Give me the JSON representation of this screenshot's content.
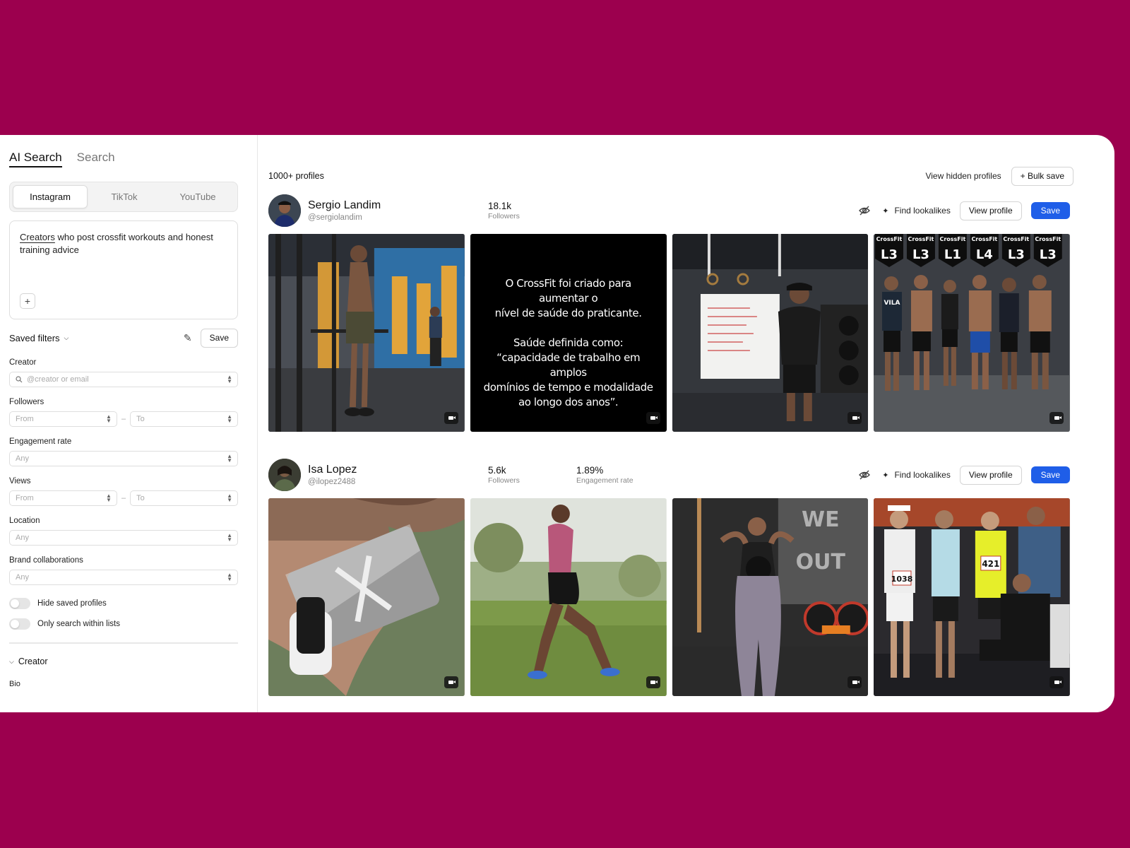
{
  "sidebar": {
    "mode_tabs": [
      "AI Search",
      "Search"
    ],
    "platform_tabs": [
      "Instagram",
      "TikTok",
      "YouTube"
    ],
    "prompt": {
      "underlined": "Creators",
      "rest": " who post crossfit workouts and honest training advice",
      "add": "+"
    },
    "saved_filters": {
      "label": "Saved filters",
      "save_label": "Save"
    },
    "creator": {
      "label": "Creator",
      "placeholder": "@creator or email"
    },
    "followers": {
      "label": "Followers",
      "from": "From",
      "to": "To",
      "dash": "–"
    },
    "engagement": {
      "label": "Engagement rate",
      "value": "Any"
    },
    "views": {
      "label": "Views",
      "from": "From",
      "to": "To",
      "dash": "–"
    },
    "location": {
      "label": "Location",
      "value": "Any"
    },
    "brand": {
      "label": "Brand collaborations",
      "value": "Any"
    },
    "toggles": [
      "Hide saved profiles",
      "Only search within lists"
    ],
    "section": "Creator",
    "bio_label": "Bio"
  },
  "main": {
    "count": "1000+ profiles",
    "view_hidden": "View hidden profiles",
    "bulk_save": "+ Bulk save",
    "find_lookalikes": "Find lookalikes",
    "view_profile": "View profile",
    "save": "Save",
    "profiles": [
      {
        "name": "Sergio Landim",
        "handle": "@sergiolandim",
        "stats": [
          {
            "value": "18.1k",
            "label": "Followers"
          }
        ],
        "quote": "O CrossFit foi criado para aumentar o\nnível de saúde do praticante.\n\nSaúde definida como:\n“capacidade de trabalho em amplos\ndomínios de tempo e modalidade\nao longo dos anos”."
      },
      {
        "name": "Isa Lopez",
        "handle": "@ilopez2488",
        "stats": [
          {
            "value": "5.6k",
            "label": "Followers"
          },
          {
            "value": "1.89%",
            "label": "Engagement rate"
          }
        ]
      }
    ]
  },
  "badges": [
    "L3",
    "L3",
    "L1",
    "L4",
    "L3",
    "L3"
  ],
  "badge_brand": "CrossFit",
  "gym_brand": "VILA",
  "bibs": [
    "1038",
    "421"
  ],
  "colors": {
    "background": "#9c004e",
    "primary": "#1f5ee8"
  }
}
